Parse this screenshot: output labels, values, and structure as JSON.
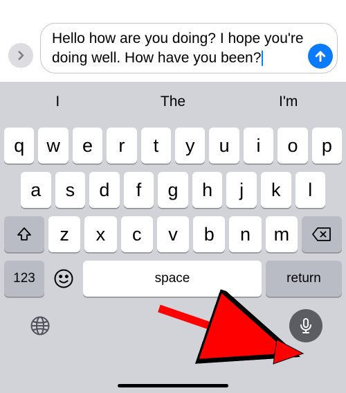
{
  "compose": {
    "text": "Hello how are you doing? I hope you're doing well. How have you been?",
    "expand_icon": "chevron-right",
    "send_icon": "arrow-up"
  },
  "suggestions": [
    "I",
    "The",
    "I'm"
  ],
  "keyboard": {
    "row1": [
      "q",
      "w",
      "e",
      "r",
      "t",
      "y",
      "u",
      "i",
      "o",
      "p"
    ],
    "row2": [
      "a",
      "s",
      "d",
      "f",
      "g",
      "h",
      "j",
      "k",
      "l"
    ],
    "row3": [
      "z",
      "x",
      "c",
      "v",
      "b",
      "n",
      "m"
    ],
    "shift_icon": "shift",
    "backspace_icon": "backspace",
    "numbers_label": "123",
    "emoji_icon": "emoji",
    "space_label": "space",
    "return_label": "return",
    "globe_icon": "globe",
    "mic_icon": "microphone"
  },
  "annotation": {
    "arrow_color": "#ff0000"
  }
}
